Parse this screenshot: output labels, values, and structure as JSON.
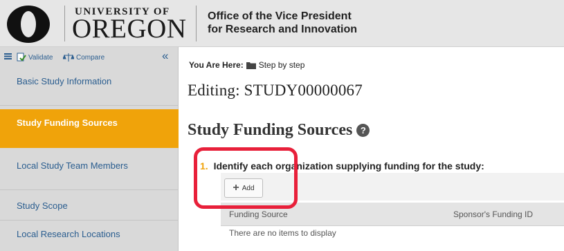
{
  "header": {
    "university_top": "UNIVERSITY OF",
    "university_main": "OREGON",
    "office_line1": "Office of the Vice President",
    "office_line2": "for Research and Innovation"
  },
  "toolbar": {
    "validate_label": "Validate",
    "compare_label": "Compare"
  },
  "sidebar": {
    "items": [
      {
        "label": "Basic Study Information"
      },
      {
        "label": "Study Funding Sources"
      },
      {
        "label": "Local Study Team Members"
      },
      {
        "label": "Study Scope"
      },
      {
        "label": "Local Research Locations"
      }
    ],
    "active_index": 1
  },
  "breadcrumb": {
    "label": "You Are Here:",
    "link": "Step by step"
  },
  "page": {
    "editing_title": "Editing: STUDY00000067",
    "section_title": "Study Funding Sources"
  },
  "question": {
    "number": "1.",
    "text": "Identify each organization supplying funding for the study:"
  },
  "add_button": {
    "label": "Add"
  },
  "table": {
    "columns": [
      "Funding Source",
      "Sponsor's Funding ID"
    ],
    "empty_text": "There are no items to display"
  },
  "colors": {
    "accent": "#f0a30a",
    "link": "#2a5d8f",
    "highlight": "#e8203a"
  }
}
